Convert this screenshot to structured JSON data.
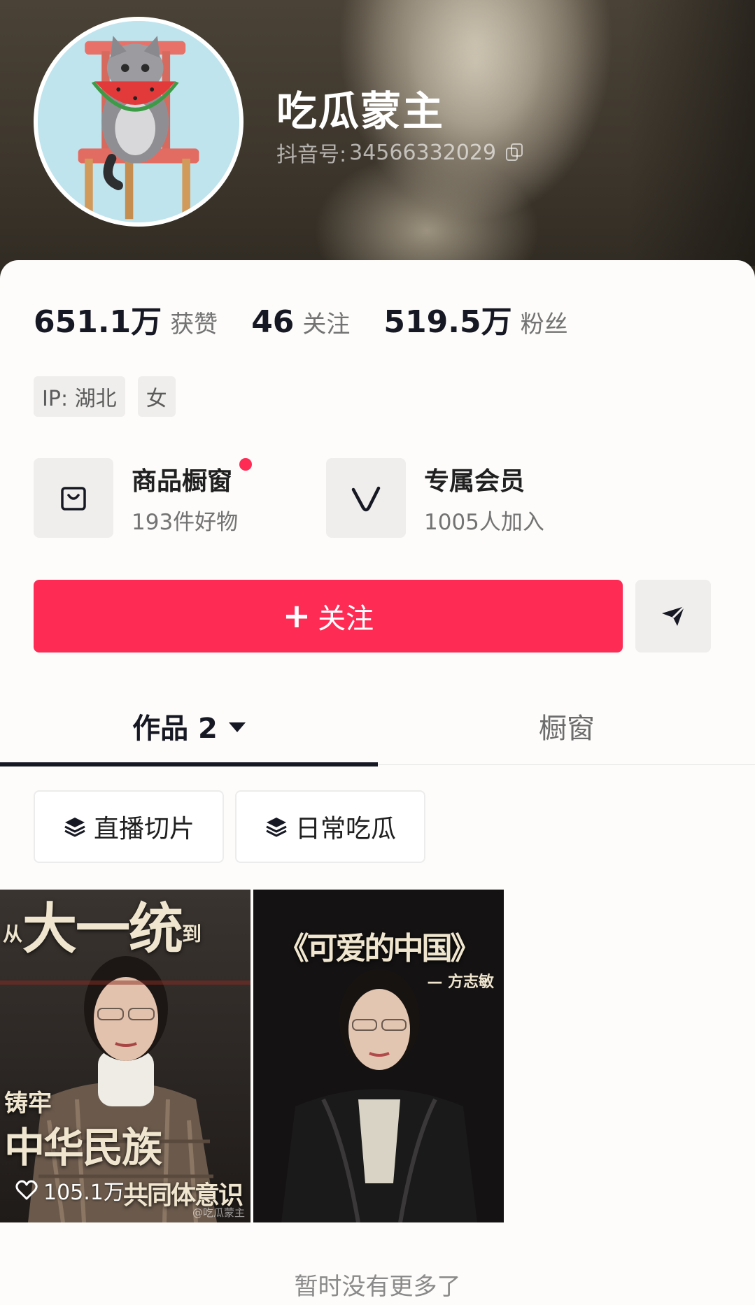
{
  "profile": {
    "nickname": "吃瓜蒙主",
    "account_label": "抖音号: ",
    "account_id": "34566332029"
  },
  "stats": [
    {
      "value": "651.1万",
      "label": "获赞"
    },
    {
      "value": "46",
      "label": "关注"
    },
    {
      "value": "519.5万",
      "label": "粉丝"
    }
  ],
  "tags": [
    "IP: 湖北",
    "女"
  ],
  "shortcuts": [
    {
      "title": "商品橱窗",
      "subtitle": "193件好物",
      "icon": "shopping-bag-icon",
      "has_dot": true
    },
    {
      "title": "专属会员",
      "subtitle": "1005人加入",
      "icon": "v-membership-icon",
      "has_dot": false
    }
  ],
  "actions": {
    "follow_label": "关注",
    "share_icon": "send-icon"
  },
  "tabs": [
    {
      "label": "作品 2",
      "active": true
    },
    {
      "label": "橱窗",
      "active": false
    }
  ],
  "collections": [
    "直播切片",
    "日常吃瓜"
  ],
  "videos": [
    {
      "headline_1": "从",
      "headline_2": "大一统",
      "headline_3": "到",
      "side_text": "铸牢",
      "big_text": "中华民族",
      "bottom_text": "共同体意识",
      "likes": "105.1万",
      "watermark": "@吃瓜蒙主"
    },
    {
      "headline": "《可爱的中国》",
      "byline": "— 方志敏"
    }
  ],
  "footer": {
    "end_text": "暂时没有更多了"
  },
  "colors": {
    "accent": "#fe2c55",
    "text_primary": "#161823",
    "text_secondary": "#737373"
  }
}
